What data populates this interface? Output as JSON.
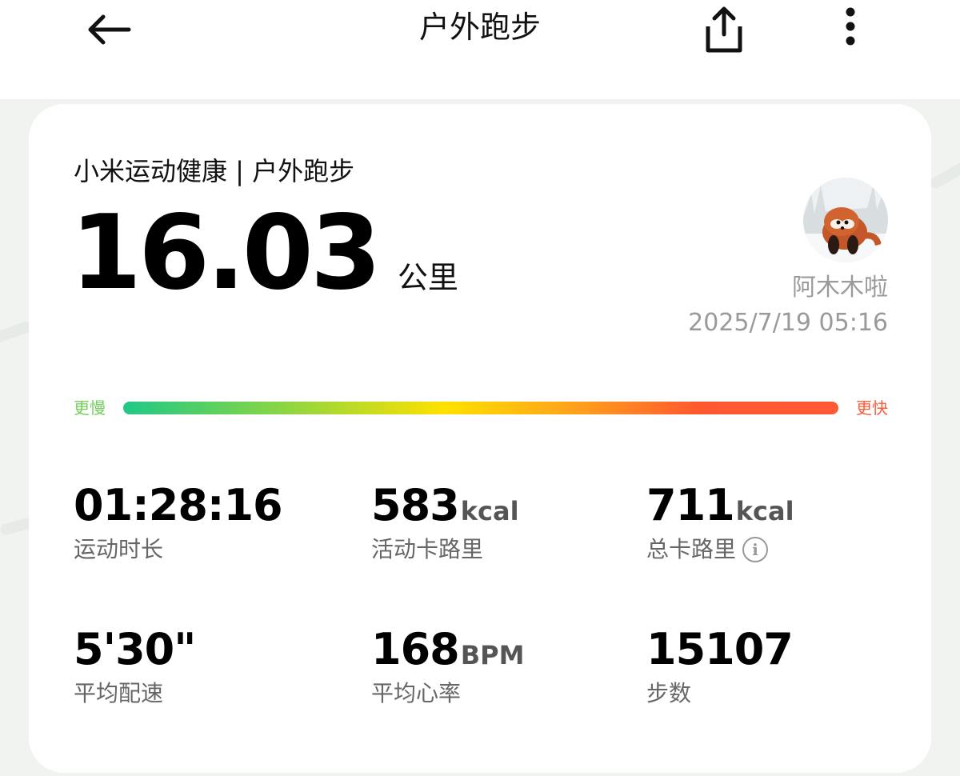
{
  "header": {
    "title": "户外跑步",
    "back_icon": "arrow-left-icon",
    "share_icon": "share-icon",
    "more_icon": "more-vertical-icon"
  },
  "summary": {
    "brand_line": "小米运动健康 | 户外跑步",
    "distance": "16.03",
    "distance_unit": "公里",
    "user_name": "阿木木啦",
    "datetime": "2025/7/19 05:16"
  },
  "pace_scale": {
    "slow_label": "更慢",
    "fast_label": "更快",
    "colors": [
      "#20c887",
      "#7fd44a",
      "#ffe100",
      "#ff9a1e",
      "#ff5a36"
    ]
  },
  "stats": {
    "duration": {
      "value": "01:28:16",
      "unit": "",
      "label": "运动时长"
    },
    "active_calories": {
      "value": "583",
      "unit": "kcal",
      "label": "活动卡路里"
    },
    "total_calories": {
      "value": "711",
      "unit": "kcal",
      "label": "总卡路里"
    },
    "avg_pace": {
      "value": "5'30\"",
      "unit": "",
      "label": "平均配速"
    },
    "avg_heart_rate": {
      "value": "168",
      "unit": "BPM",
      "label": "平均心率"
    },
    "steps": {
      "value": "15107",
      "unit": "",
      "label": "步数"
    }
  }
}
